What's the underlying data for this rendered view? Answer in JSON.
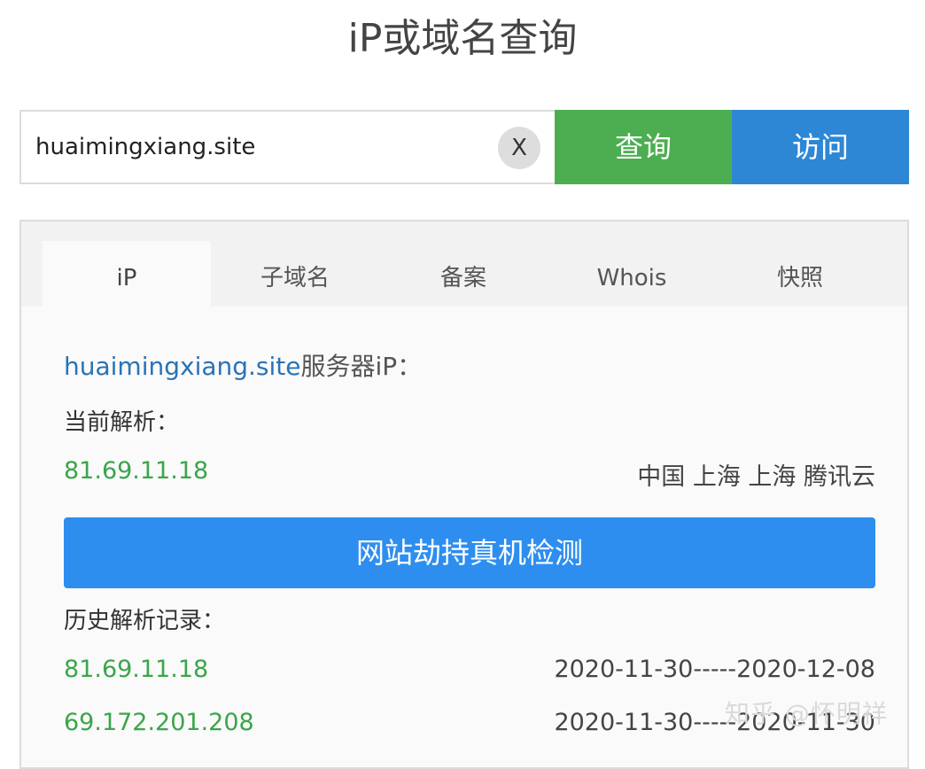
{
  "page_title": "iP或域名查询",
  "search": {
    "value": "huaimingxiang.site",
    "clear_label": "X",
    "query_label": "查询",
    "visit_label": "访问"
  },
  "tabs": [
    {
      "label": "iP",
      "active": true
    },
    {
      "label": "子域名",
      "active": false
    },
    {
      "label": "备案",
      "active": false
    },
    {
      "label": "Whois",
      "active": false
    },
    {
      "label": "快照",
      "active": false
    }
  ],
  "result": {
    "domain": "huaimingxiang.site",
    "server_suffix": "服务器iP：",
    "current_label": "当前解析：",
    "current": {
      "ip": "81.69.11.18",
      "location": "中国 上海 上海 腾讯云"
    },
    "detect_button": "网站劫持真机检测",
    "history_label": "历史解析记录：",
    "history": [
      {
        "ip": "81.69.11.18",
        "range": "2020-11-30-----2020-12-08"
      },
      {
        "ip": "69.172.201.208",
        "range": "2020-11-30-----2020-11-30"
      }
    ]
  },
  "watermark": "知乎 @怀明祥",
  "colors": {
    "query_button": "#4cae50",
    "visit_button": "#2e87d5",
    "detect_button": "#2e8ef0",
    "ip_text": "#3ba54a",
    "domain_text": "#2a73b5"
  }
}
